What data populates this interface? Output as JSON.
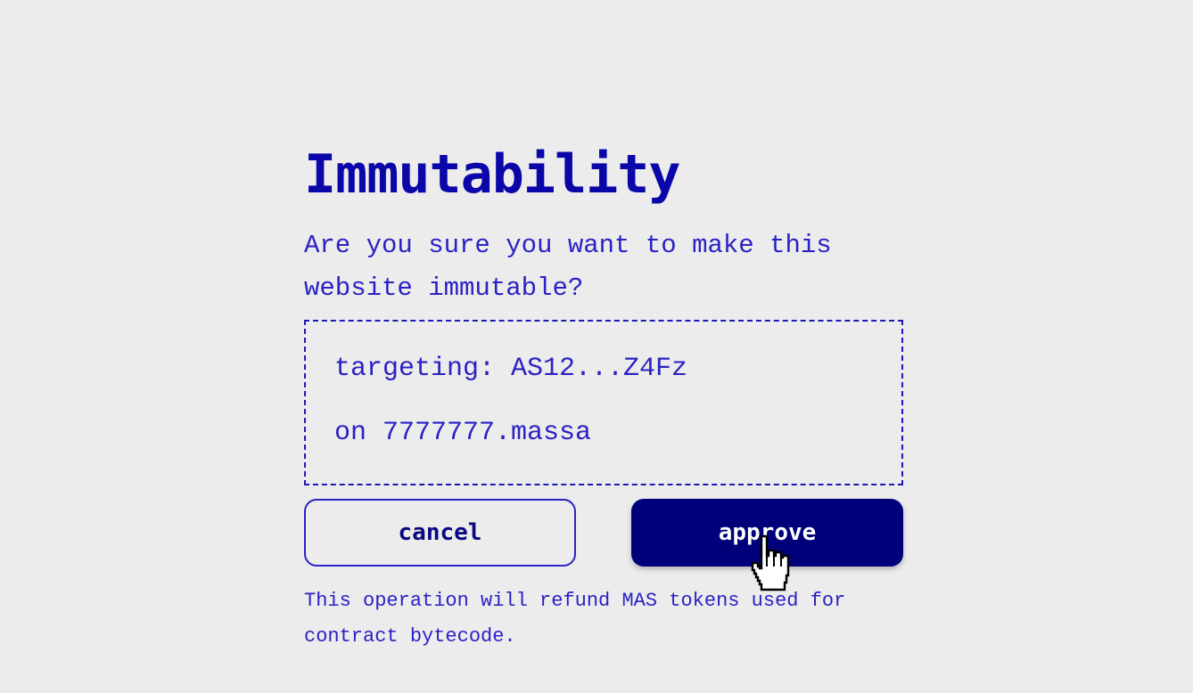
{
  "dialog": {
    "title": "Immutability",
    "question": "Are you sure you want to make this website immutable?",
    "details": {
      "targeting": "targeting: AS12...Z4Fz",
      "domain": "on 7777777.massa"
    },
    "buttons": {
      "cancel_label": "cancel",
      "approve_label": "approve"
    },
    "note": "This operation will refund MAS tokens used for contract bytecode."
  },
  "colors": {
    "background": "#ececec",
    "primary": "#00007a",
    "accent_text": "#2a22c4"
  },
  "icons": {
    "cursor": "hand-pointer-cursor-icon"
  }
}
